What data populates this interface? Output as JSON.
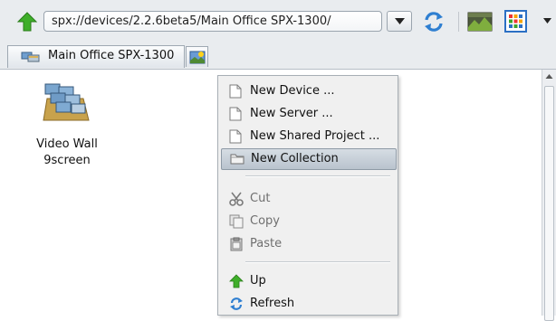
{
  "toolbar": {
    "up_icon": "green-up-arrow-icon",
    "address": "spx://devices/2.2.6beta5/Main Office SPX-1300/",
    "refresh_icon": "refresh-icon",
    "screen_icon": "screen-image-icon",
    "view_icon": "grid-view-icon"
  },
  "tabs": [
    {
      "label": "Main Office SPX-1300",
      "icon": "device-group-icon"
    }
  ],
  "new_tab_icon": "new-tab-image-icon",
  "items": [
    {
      "label": "Video Wall 9screen",
      "icon": "video-wall-icon"
    }
  ],
  "context_menu": {
    "groups": [
      [
        {
          "label": "New Device ...",
          "icon": "page-icon"
        },
        {
          "label": "New Server ...",
          "icon": "page-icon"
        },
        {
          "label": "New Shared Project ...",
          "icon": "page-icon"
        },
        {
          "label": "New Collection",
          "icon": "folder-icon",
          "highlighted": true
        }
      ],
      [
        {
          "label": "Cut",
          "icon": "scissors-icon",
          "disabled": true
        },
        {
          "label": "Copy",
          "icon": "copy-icon",
          "disabled": true
        },
        {
          "label": "Paste",
          "icon": "paste-icon",
          "disabled": true
        }
      ],
      [
        {
          "label": "Up",
          "icon": "green-up-arrow-icon"
        },
        {
          "label": "Refresh",
          "icon": "refresh-icon"
        }
      ]
    ]
  },
  "colors": {
    "chrome": "#e9ecef",
    "menu_bg": "#f0f0f0",
    "highlight": "#b9c3cd",
    "up_arrow": "#3fae2a",
    "refresh": "#2f7fd1"
  }
}
